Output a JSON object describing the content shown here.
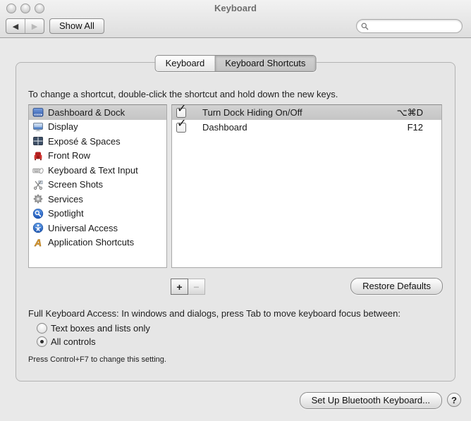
{
  "window": {
    "title": "Keyboard"
  },
  "toolbar": {
    "back_label": "◀",
    "forward_label": "▶",
    "show_all_label": "Show All",
    "search": {
      "value": "",
      "placeholder": ""
    }
  },
  "tabs": [
    {
      "label": "Keyboard",
      "selected": false
    },
    {
      "label": "Keyboard Shortcuts",
      "selected": true
    }
  ],
  "instruction": "To change a shortcut, double-click the shortcut and hold down the new keys.",
  "categories": [
    {
      "label": "Dashboard & Dock",
      "icon": "dock-icon",
      "selected": true
    },
    {
      "label": "Display",
      "icon": "display-icon",
      "selected": false
    },
    {
      "label": "Exposé & Spaces",
      "icon": "expose-spaces-icon",
      "selected": false
    },
    {
      "label": "Front Row",
      "icon": "front-row-icon",
      "selected": false
    },
    {
      "label": "Keyboard & Text Input",
      "icon": "keyboard-mouse-icon",
      "selected": false
    },
    {
      "label": "Screen Shots",
      "icon": "screen-shots-icon",
      "selected": false
    },
    {
      "label": "Services",
      "icon": "gear-icon",
      "selected": false
    },
    {
      "label": "Spotlight",
      "icon": "spotlight-icon",
      "selected": false
    },
    {
      "label": "Universal Access",
      "icon": "universal-access-icon",
      "selected": false
    },
    {
      "label": "Application Shortcuts",
      "icon": "application-shortcuts-icon",
      "selected": false
    }
  ],
  "shortcuts": {
    "rows": [
      {
        "checked": true,
        "label": "Turn Dock Hiding On/Off",
        "shortcut": "⌥⌘D",
        "selected": true
      },
      {
        "checked": true,
        "label": "Dashboard",
        "shortcut": "F12",
        "selected": false
      }
    ]
  },
  "list_controls": {
    "add_label": "+",
    "remove_label": "−",
    "restore_defaults_label": "Restore Defaults"
  },
  "full_keyboard_access": {
    "description": "Full Keyboard Access: In windows and dialogs, press Tab to move keyboard focus between:",
    "options": [
      {
        "label": "Text boxes and lists only",
        "selected": false
      },
      {
        "label": "All controls",
        "selected": true
      }
    ],
    "note": "Press Control+F7 to change this setting."
  },
  "footer": {
    "bluetooth_button_label": "Set Up Bluetooth Keyboard...",
    "help_label": "?"
  },
  "colors": {
    "window_bg": "#e9e9e9",
    "selection_inactive": "#c9c9c9",
    "list_bg": "#ffffff",
    "icon_blue": "#2f66c0",
    "front_row_red": "#c0272d",
    "application_a_gold": "#e09c2f"
  }
}
